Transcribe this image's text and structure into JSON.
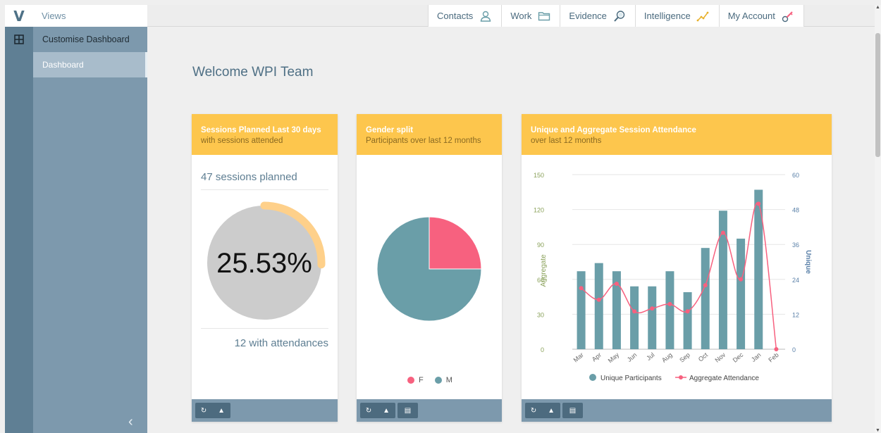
{
  "app": {
    "logo": "V",
    "views_label": "Views"
  },
  "sidebar": {
    "items": [
      {
        "label": "Customise Dashboard"
      },
      {
        "label": "Dashboard"
      }
    ]
  },
  "nav": {
    "items": [
      {
        "label": "Contacts",
        "icon": "contacts-icon"
      },
      {
        "label": "Work",
        "icon": "folder-icon"
      },
      {
        "label": "Evidence",
        "icon": "magnifier-icon"
      },
      {
        "label": "Intelligence",
        "icon": "trend-icon"
      },
      {
        "label": "My Account",
        "icon": "key-icon"
      }
    ]
  },
  "welcome": "Welcome WPI Team",
  "cards": {
    "sessions": {
      "title": "Sessions Planned Last 30 days",
      "subtitle": "with sessions attended",
      "planned_text": "47 sessions planned",
      "percent_text": "25.53%",
      "percent_value": 25.53,
      "attendances_text": "12 with attendances"
    },
    "gender": {
      "title": "Gender split",
      "subtitle": "Participants over last 12 months"
    },
    "attendance": {
      "title": "Unique and Aggregate Session Attendance",
      "subtitle": "over last 12 months"
    }
  },
  "chart_data": [
    {
      "type": "pie",
      "labels": [
        "F",
        "M"
      ],
      "values": [
        25,
        75
      ],
      "colors": [
        "#f7617f",
        "#6a9ea8"
      ]
    },
    {
      "type": "bar",
      "categories": [
        "Mar",
        "Apr",
        "May",
        "Jun",
        "Jul",
        "Aug",
        "Sep",
        "Oct",
        "Nov",
        "Dec",
        "Jan",
        "Feb"
      ],
      "series": [
        {
          "name": "Unique Participants",
          "axis": "left",
          "values": [
            67,
            74,
            67,
            54,
            54,
            67,
            49,
            87,
            119,
            95,
            137,
            0
          ],
          "color": "#6a9ea8"
        },
        {
          "name": "Aggregate Attendance",
          "axis": "right",
          "values": [
            21,
            17,
            22.5,
            13,
            14,
            15.5,
            13,
            22,
            40,
            24,
            50,
            0
          ],
          "color": "#f7617f"
        }
      ],
      "ylabel": "Aggregate",
      "y2label": "Unique",
      "ylim": [
        0,
        150
      ],
      "y2lim": [
        0,
        60
      ],
      "yticks": [
        0,
        30,
        60,
        90,
        120,
        150
      ],
      "y2ticks": [
        0,
        12,
        24,
        36,
        48,
        60
      ],
      "legend": "bottom",
      "grid": true
    }
  ]
}
